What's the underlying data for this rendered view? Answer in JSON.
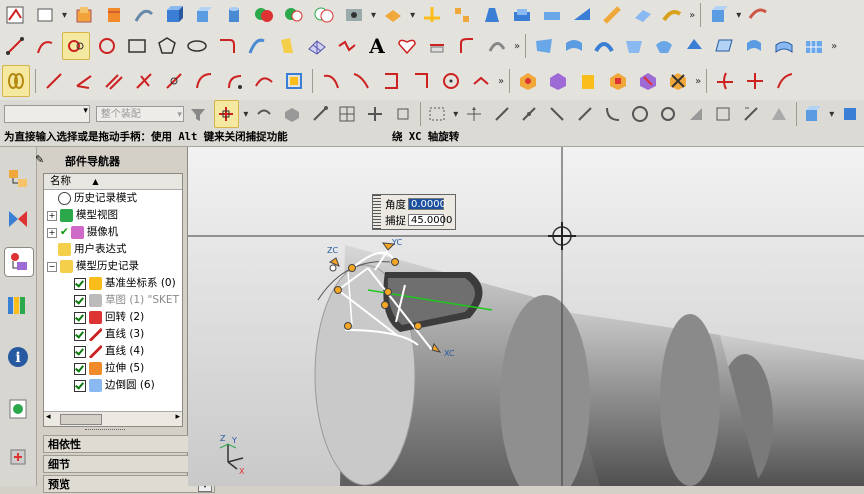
{
  "status": {
    "prompt": "为直接输入选择或是拖动手柄：使用 Alt 键来关闭捕捉功能",
    "mode": "绕 XC 轴旋转"
  },
  "selection_bar": {
    "filter_value": "",
    "scope_value": "整个装配"
  },
  "navigator": {
    "title": "部件导航器",
    "column_header": "名称",
    "items": [
      {
        "label": "历史记录模式",
        "dim": false
      },
      {
        "label": "模型视图",
        "dim": false
      },
      {
        "label": "摄像机",
        "dim": false
      },
      {
        "label": "用户表达式",
        "dim": false
      },
      {
        "label": "模型历史记录",
        "dim": false
      },
      {
        "label": "基准坐标系 (0)",
        "dim": false
      },
      {
        "label": "草图 (1) \"SKET",
        "dim": true
      },
      {
        "label": "回转 (2)",
        "dim": false
      },
      {
        "label": "直线 (3)",
        "dim": false
      },
      {
        "label": "直线 (4)",
        "dim": false
      },
      {
        "label": "拉伸 (5)",
        "dim": false
      },
      {
        "label": "边倒圆 (6)",
        "dim": false
      }
    ],
    "sections": [
      "相依性",
      "细节",
      "预览"
    ]
  },
  "dialog": {
    "angle_label": "角度",
    "angle_value": "0.0000",
    "snap_label": "捕捉",
    "snap_value": "45.0000"
  },
  "toolbar": {
    "more_glyph": "»",
    "text_tool_glyph": "A"
  },
  "axes": {
    "x": "X",
    "y": "Y",
    "z": "Z",
    "xc": "XC",
    "yc": "YC",
    "zc": "ZC"
  }
}
